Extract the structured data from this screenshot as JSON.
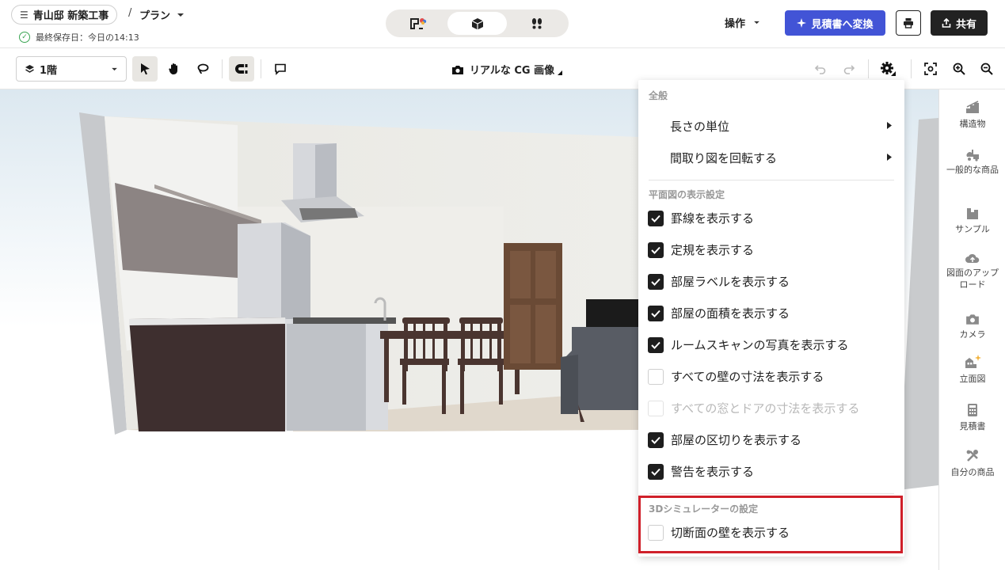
{
  "header": {
    "project_name": "青山邸 新築工事",
    "separator": "/",
    "plan_name": "プラン",
    "saved_text": "最終保存日：今日の14:13",
    "view_modes": [
      {
        "icon": "floorplan-2d-icon"
      },
      {
        "icon": "cube-3d-icon",
        "active": true
      },
      {
        "icon": "walkthrough-footprints-icon"
      }
    ],
    "operations_label": "操作",
    "estimate_button": "見積書へ変換",
    "share_button": "共有",
    "accent_color": "#4254d6"
  },
  "toolbar": {
    "floor_select_value": "1階",
    "render_button": "リアルな CG 画像"
  },
  "dropdown": {
    "section_general": "全般",
    "submenus": [
      "長さの単位",
      "間取り図を回転する"
    ],
    "section_plan_display": "平面図の表示設定",
    "options": [
      {
        "label": "罫線を表示する",
        "checked": true
      },
      {
        "label": "定規を表示する",
        "checked": true
      },
      {
        "label": "部屋ラベルを表示する",
        "checked": true
      },
      {
        "label": "部屋の面積を表示する",
        "checked": true
      },
      {
        "label": "ルームスキャンの写真を表示する",
        "checked": true
      },
      {
        "label": "すべての壁の寸法を表示する",
        "checked": false
      },
      {
        "label": "すべての窓とドアの寸法を表示する",
        "checked": false,
        "disabled": true
      },
      {
        "label": "部屋の区切りを表示する",
        "checked": true
      },
      {
        "label": "警告を表示する",
        "checked": true
      }
    ],
    "section_3d": "3Dシミュレーターの設定",
    "option_3d": {
      "label": "切断面の壁を表示する",
      "checked": false
    },
    "highlight_color": "#d0202a"
  },
  "sidebar": {
    "items": [
      {
        "label": "構造物",
        "icon": "structure-icon"
      },
      {
        "label": "一般的な商品",
        "icon": "general-products-icon"
      },
      {
        "label": "サンプル",
        "icon": "sample-house-icon"
      },
      {
        "label": "図面のアップロード",
        "icon": "upload-cloud-icon"
      },
      {
        "label": "カメラ",
        "icon": "camera-icon"
      },
      {
        "label": "立面図",
        "icon": "elevation-icon"
      },
      {
        "label": "見積書",
        "icon": "calculator-icon"
      },
      {
        "label": "自分の商品",
        "icon": "my-products-tools-icon"
      }
    ]
  }
}
